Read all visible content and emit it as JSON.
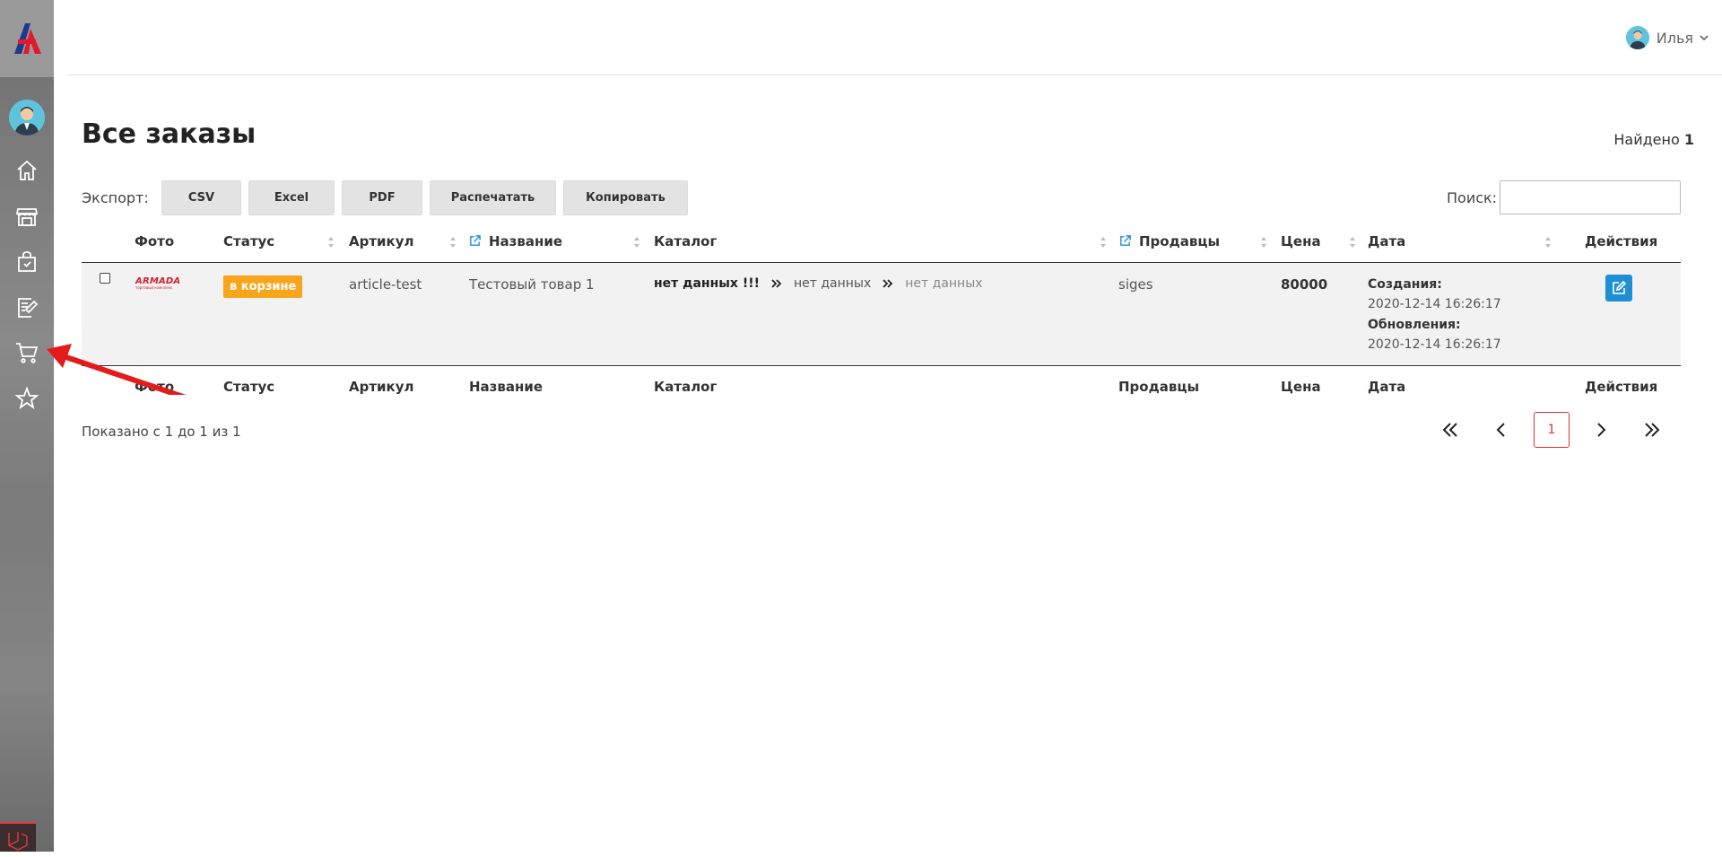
{
  "user": {
    "name": "Илья"
  },
  "page": {
    "title": "Все заказы",
    "found_label": "Найдено",
    "found_count": "1"
  },
  "toolbar": {
    "export_label": "Экспорт:",
    "buttons": [
      "CSV",
      "Excel",
      "PDF",
      "Распечатать",
      "Копировать"
    ],
    "search_label": "Поиск:",
    "search_value": ""
  },
  "table": {
    "headers": [
      "Фото",
      "Статус",
      "Артикул",
      "Название",
      "Каталог",
      "Продавцы",
      "Цена",
      "Дата",
      "Действия"
    ],
    "row": {
      "brand_name": "ARMADA",
      "brand_sub": "торговый комплекс",
      "status": "в корзине",
      "article": "article-test",
      "name": "Тестовый товар 1",
      "catalog": [
        "нет данных !!!",
        "нет данных",
        "нет данных"
      ],
      "seller": "siges",
      "price": "80000",
      "created_label": "Создания:",
      "created": "2020-12-14 16:26:17",
      "updated_label": "Обновления:",
      "updated": "2020-12-14 16:26:17"
    }
  },
  "pagination": {
    "info": "Показано с 1 до 1 из 1",
    "current": "1"
  },
  "colors": {
    "badge": "#f8a51b",
    "edit": "#1f8fd3",
    "accent": "#e03c3c",
    "annotation_arrow": "#e31b1b"
  },
  "icons": [
    "home-icon",
    "store-icon",
    "shopping-bag-icon",
    "edit-document-icon",
    "cart-icon",
    "star-icon",
    "chevron-down-icon",
    "external-link-icon",
    "edit-icon"
  ]
}
